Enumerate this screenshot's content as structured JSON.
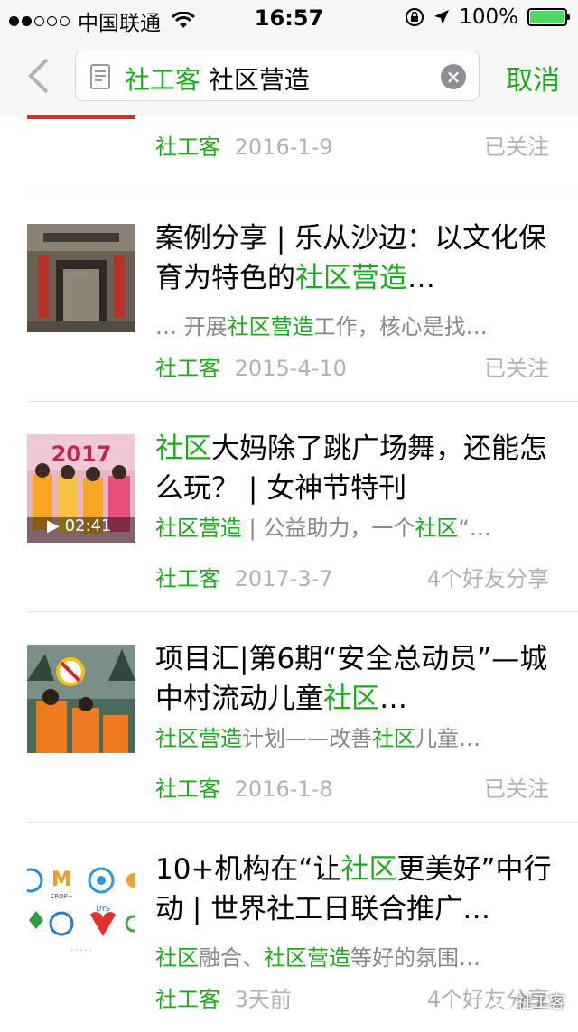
{
  "status_bar": {
    "carrier": "中国联通",
    "time": "16:57",
    "battery": "100%",
    "battery_level": 1.0
  },
  "nav": {
    "search_keyword_account": "社工客",
    "search_keyword_topic": "社区营造",
    "cancel_label": "取消"
  },
  "first_item": {
    "source": "社工客",
    "date": "2016-1-9",
    "status": "已关注"
  },
  "items": [
    {
      "title_parts": [
        "案例分享 | 乐从沙边：以文化保育为特色的",
        "社区营造",
        "…"
      ],
      "snippet_parts": [
        "… 开展",
        "社区营造",
        "工作，核心是找…"
      ],
      "source": "社工客",
      "date": "2015-4-10",
      "status": "已关注"
    },
    {
      "title_parts": [
        "社区",
        "大妈除了跳广场舞，还能怎么玩？ | 女神节特刊"
      ],
      "snippet_parts": [
        "社区营造",
        " | 公益助力，一个",
        "社区",
        "“…"
      ],
      "source": "社工客",
      "date": "2017-3-7",
      "status": "4个好友分享",
      "video_duration": "02:41"
    },
    {
      "title_parts": [
        "项目汇|第6期“安全总动员”—城中村流动儿童",
        "社区",
        "…"
      ],
      "snippet_parts": [
        "社区营造",
        "计划——改善",
        "社区",
        "儿童…"
      ],
      "source": "社工客",
      "date": "2016-1-8",
      "status": "已关注"
    },
    {
      "title_parts": [
        "10+机构在“让",
        "社区",
        "更美好”中行动 | 世界社工日联合推广…"
      ],
      "snippet_parts": [
        "社区",
        "融合、",
        "社区营造",
        "等好的氛围…"
      ],
      "source": "社工客",
      "date": "3天前",
      "status": "4个好友分享"
    }
  ],
  "watermark": "社工客",
  "colors": {
    "accent": "#1aad19",
    "muted": "#b2b2b2",
    "snippet": "#888888"
  }
}
